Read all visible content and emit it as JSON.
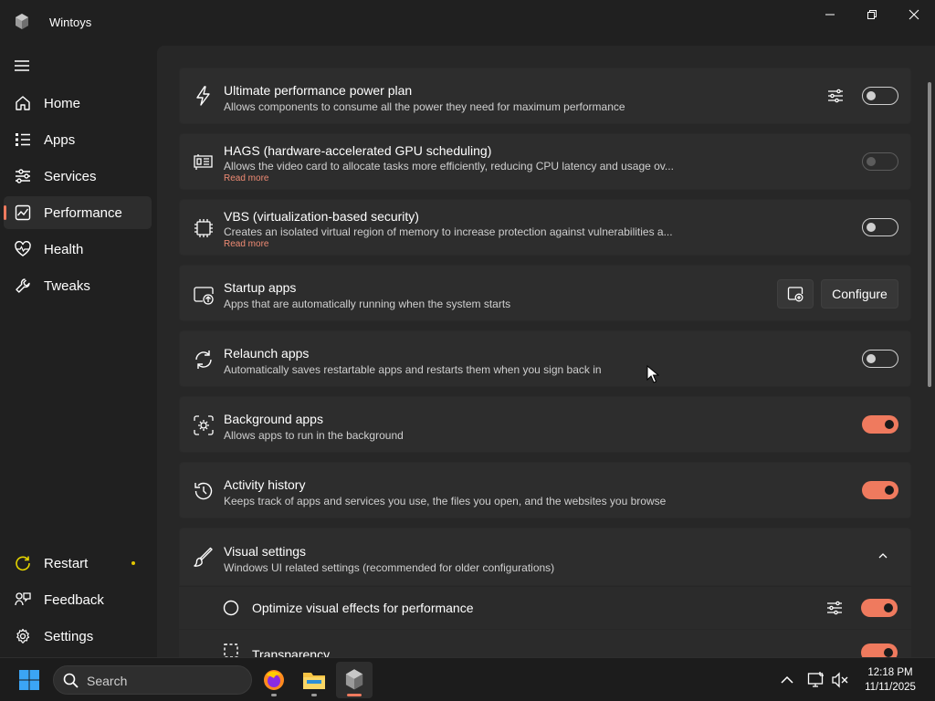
{
  "app": {
    "title": "Wintoys"
  },
  "nav": {
    "items": [
      {
        "label": "Home",
        "icon": "home-icon"
      },
      {
        "label": "Apps",
        "icon": "apps-list-icon"
      },
      {
        "label": "Services",
        "icon": "services-icon"
      },
      {
        "label": "Performance",
        "icon": "performance-icon",
        "selected": true
      },
      {
        "label": "Health",
        "icon": "health-icon"
      },
      {
        "label": "Tweaks",
        "icon": "wrench-icon"
      }
    ],
    "footer": [
      {
        "label": "Restart",
        "icon": "restart-icon",
        "badge": "dot"
      },
      {
        "label": "Feedback",
        "icon": "feedback-icon"
      },
      {
        "label": "Settings",
        "icon": "gear-icon"
      }
    ]
  },
  "settings": [
    {
      "title": "Ultimate performance power plan",
      "desc": "Allows components to consume all the power they need for maximum performance",
      "toggle": "off",
      "has_tune": true
    },
    {
      "title": "HAGS (hardware-accelerated GPU scheduling)",
      "desc": "Allows the video card to allocate tasks more efficiently, reducing CPU latency and usage ov...",
      "link": "Read more",
      "toggle": "disabled"
    },
    {
      "title": "VBS (virtualization-based security)",
      "desc": "Creates an isolated virtual region of memory to increase protection against vulnerabilities a...",
      "link": "Read more",
      "toggle": "off"
    },
    {
      "title": "Startup apps",
      "desc": "Apps that are automatically running when the system starts",
      "button": "Configure"
    },
    {
      "title": "Relaunch apps",
      "desc": "Automatically saves restartable apps and restarts them when you sign back in",
      "toggle": "off"
    },
    {
      "title": "Background apps",
      "desc": "Allows apps to run in the background",
      "toggle": "on"
    },
    {
      "title": "Activity history",
      "desc": "Keeps track of apps and services you use, the files you open, and the websites you browse",
      "toggle": "on"
    },
    {
      "title": "Visual settings",
      "desc": "Windows UI related settings (recommended for older configurations)",
      "expanded": true
    }
  ],
  "visual_sub": [
    {
      "title": "Optimize visual effects for performance",
      "toggle": "on",
      "has_tune": true
    },
    {
      "title": "Transparency",
      "toggle": "on"
    }
  ],
  "taskbar": {
    "search_placeholder": "Search",
    "time": "12:18 PM",
    "date": "11/11/2025"
  },
  "colors": {
    "accent": "#ef7a5e",
    "background": "#202020",
    "card": "#2d2d2d"
  }
}
